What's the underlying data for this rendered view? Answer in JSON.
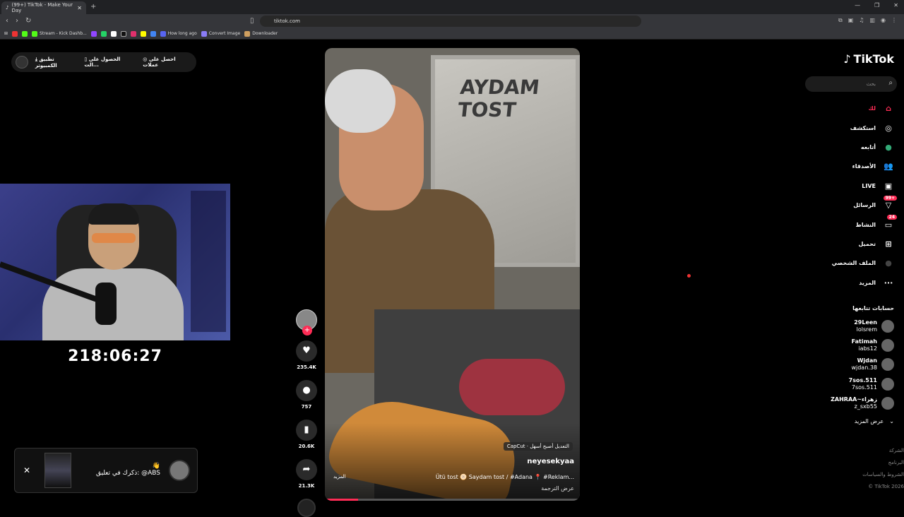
{
  "browser": {
    "tab_title": "(99+) TikTok - Make Your Day",
    "url": "tiktok.com",
    "bookmarks": [
      "Stream - Kick Dashb...",
      "How long ago",
      "Convert Image",
      "Downloader"
    ]
  },
  "download_bar": {
    "app_label": "تطبيق الكمبيوتر",
    "get_label": "الحصول على الت...",
    "coins_label": "احصل على عملات"
  },
  "stream": {
    "timer": "218:06:27"
  },
  "notification": {
    "text": "ذكرك في تعليق: @ABS"
  },
  "video": {
    "sign_line1": "AYDAM",
    "sign_line2": "TOST",
    "capcut": "CapCut · التعديل أصبح أسهل",
    "author": "neyesekyaa",
    "caption": "Ütü tost 🫓 Saydam tost / #Adana 📍 #Reklam...",
    "more": "المزيد",
    "translate": "عرض الترجمة",
    "progress": 0.13
  },
  "actions": {
    "likes": "235.4K",
    "comments": "757",
    "saves": "20.6K",
    "shares": "21.3K"
  },
  "sidebar": {
    "logo": "TikTok",
    "search_placeholder": "بحث",
    "nav": [
      {
        "label": "لك",
        "icon": "⌂"
      },
      {
        "label": "استكشف",
        "icon": "◎"
      },
      {
        "label": "أتابعه",
        "icon": "●"
      },
      {
        "label": "الأصدقاء",
        "icon": "👥"
      },
      {
        "label": "LIVE",
        "icon": "▣"
      },
      {
        "label": "الرسائل",
        "icon": "▽",
        "badge": "99+"
      },
      {
        "label": "النشاط",
        "icon": "▭",
        "badge": "24"
      },
      {
        "label": "تحميل",
        "icon": "⊞"
      },
      {
        "label": "الملف الشخصي",
        "icon": "●"
      },
      {
        "label": "المزيد",
        "icon": "···"
      }
    ],
    "following_title": "حسابات تتابعها",
    "following": [
      {
        "name": "29Leen",
        "user": "lolsrem"
      },
      {
        "name": "Fatimah",
        "user": "iabs12"
      },
      {
        "name": "Wjdan",
        "user": "wjdan.38"
      },
      {
        "name": "7sos.511",
        "user": "7sos.511"
      },
      {
        "name": "ZAHRAA~زهراء",
        "user": "z_sxb55"
      }
    ],
    "see_more": "عرض المزيد",
    "footer": [
      "الشركة",
      "البرنامج",
      "الشروط والسياسات",
      "© TikTok 2026"
    ]
  },
  "colors": {
    "accent": "#fe2c55"
  }
}
